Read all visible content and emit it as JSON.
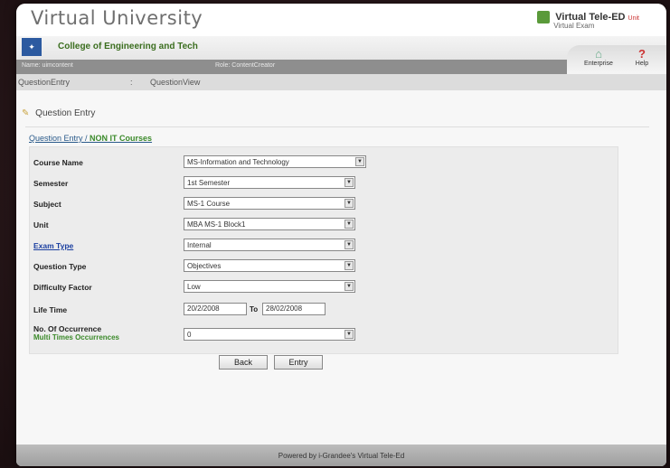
{
  "header": {
    "brand": "Virtual University",
    "vt_name": "Virtual Tele-ED",
    "vt_sub": "Virtual Exam",
    "vt_tag": "Unit",
    "college": "College of Engineering and Tech",
    "status_left": "Name: uimcontent",
    "status_mid": "Role: ContentCreator",
    "home_label": "Enterprise",
    "help_label": "Help"
  },
  "menu": {
    "item1": "QuestionEntry",
    "sep": ":",
    "item2": "QuestionView"
  },
  "page": {
    "title": "Question Entry",
    "crumb_a": "Question Entry / ",
    "crumb_b": "NON IT Courses"
  },
  "form": {
    "course_label": "Course Name",
    "course_value": "MS-Information and Technology",
    "semester_label": "Semester",
    "semester_value": "1st Semester",
    "subject_label": "Subject",
    "subject_value": "MS-1 Course",
    "unit_label": "Unit",
    "unit_value": "MBA MS-1 Block1",
    "exam_label": "Exam Type",
    "exam_value": "Internal",
    "qtype_label": "Question Type",
    "qtype_value": "Objectives",
    "diff_label": "Difficulty Factor",
    "diff_value": "Low",
    "life_label": "Life Time",
    "life_from": "20/2/2008",
    "life_to_label": "To",
    "life_to": "28/02/2008",
    "occ_label": "No. Of Occurrence",
    "occ_sub": "Multi Times Occurrences",
    "occ_value": "0"
  },
  "buttons": {
    "back": "Back",
    "entry": "Entry"
  },
  "footer": "Powered by i-Grandee's Virtual Tele-Ed",
  "arrow_glyph": "▼"
}
